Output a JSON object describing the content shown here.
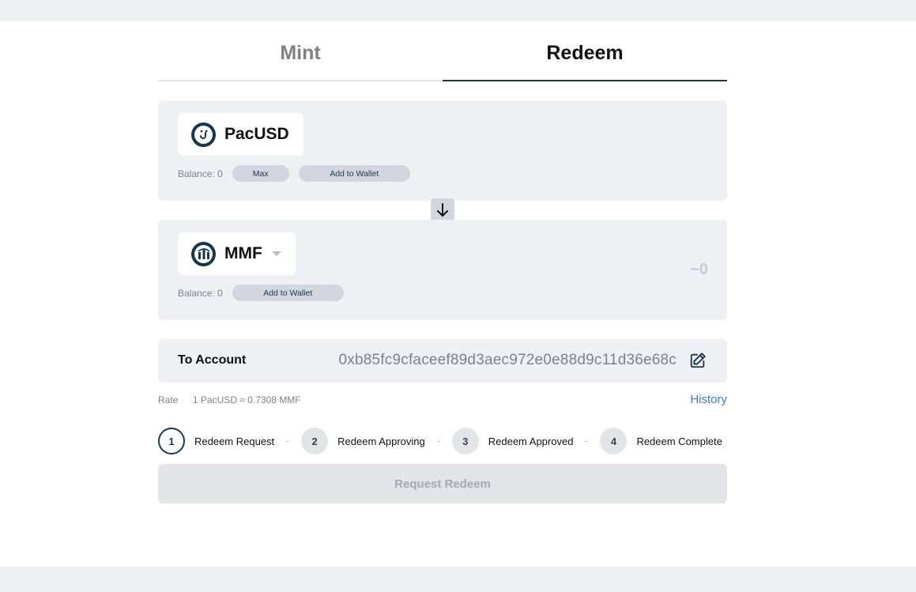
{
  "tabs": [
    {
      "label": "Mint",
      "active": false
    },
    {
      "label": "Redeem",
      "active": true
    }
  ],
  "from": {
    "token": "PacUSD",
    "icon": "pacusd-logo-icon",
    "balance": "Balance: 0",
    "max_label": "Max",
    "add_wallet_label": "Add to Wallet"
  },
  "swap_icon": "arrow-down-icon",
  "to": {
    "token": "MMF",
    "icon": "mmf-logo-icon",
    "balance": "Balance: 0",
    "add_wallet_label": "Add to Wallet",
    "amount": "~0"
  },
  "account": {
    "label": "To Account",
    "address": "0xb85fc9cfaceef89d3aec972e0e88d9c11d36e68c",
    "edit_icon": "edit-icon"
  },
  "rate": {
    "label": "Rate",
    "value": "1 PacUSD ≈ 0.7308 MMF",
    "history_label": "History"
  },
  "steps": [
    {
      "num": "1",
      "label": "Redeem Request",
      "current": true
    },
    {
      "num": "2",
      "label": "Redeem Approving",
      "current": false
    },
    {
      "num": "3",
      "label": "Redeem Approved",
      "current": false
    },
    {
      "num": "4",
      "label": "Redeem Complete",
      "current": false
    }
  ],
  "submit_label": "Request Redeem",
  "colors": {
    "brand": "#1c3550",
    "link": "#3f7bc4",
    "panel": "#eff0f3"
  }
}
